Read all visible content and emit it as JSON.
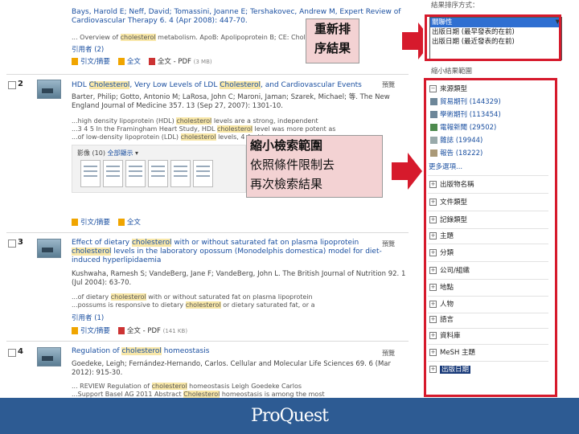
{
  "results": [
    {
      "num": "",
      "title_a": "Bays, Harold E; Neff, David; Tomassini, Joanne E; Tershakovec, Andrew M, Expert Review of",
      "title_b": "Cardiovascular Therapy 6. 4 (Apr 2008): 447-70.",
      "snippet": "... Overview of cholesterol metabolism. ApoB: Apolipoprotein B; CE: Chol",
      "cited": "引用者 (2)",
      "links": [
        "引文/摘要",
        "全文",
        "全文 - PDF"
      ],
      "pdf_size": "(3 MB)"
    },
    {
      "num": "2",
      "title_a": "HDL Cholesterol, Very Low Levels of LDL Cholesterol, and Cardiovascular Events",
      "meta_a": "Barter, Philip; Gotto, Antonio M; LaRosa, John C; Maroni, Jaman; Szarek, Michael; 等. The New",
      "meta_b": "England Journal of Medicine 357. 13 (Sep 27, 2007): 1301-10.",
      "snip_a": "...high density lipoprotein (HDL) cholesterol levels are a strong, independent",
      "snip_b": "...3 4 5 In the Framingham Heart Study, HDL cholesterol level was more potent as",
      "snip_c": "...of low-density lipoprotein (LDL) cholesterol levels, 4 And inv",
      "figures_label": "影像 (10)",
      "figures_all": "全部顯示",
      "links": [
        "引文/摘要",
        "全文"
      ],
      "preview": "預覽"
    },
    {
      "num": "3",
      "title_a": "Effect of dietary cholesterol with or without saturated fat on plasma lipoprotein",
      "title_b": "cholesterol levels in the laboratory opossum (Monodelphis domestica) model for diet-",
      "title_c": "induced hyperlipidaemia",
      "meta_a": "Kushwaha, Ramesh S; VandeBerg, Jane F; VandeBerg, John L. The British Journal of Nutrition 92. 1",
      "meta_b": "(Jul 2004): 63-70.",
      "snip_a": "...of dietary cholesterol with or without saturated fat on plasma lipoprotein",
      "snip_b": "...possums is responsive to dietary cholesterol or dietary saturated fat, or a",
      "cited": "引用者 (1)",
      "links": [
        "引文/摘要",
        "全文 - PDF"
      ],
      "pdf_size": "(141 KB)",
      "preview": "預覽"
    },
    {
      "num": "4",
      "title_a": "Regulation of cholesterol homeostasis",
      "meta_a": "Goedeke, Leigh; Fernández-Hernando, Carlos. Cellular and Molecular Life Sciences 69. 6 (Mar",
      "meta_b": "2012): 915-30.",
      "snip_a": "... REVIEW Regulation of cholesterol homeostasis Leigh Goedeke Carlos",
      "snip_b": "...Support Basel AG 2011 Abstract Cholesterol homeostasis is among the most",
      "preview": "預覽"
    }
  ],
  "callouts": {
    "resort": [
      "重新排",
      "序結果"
    ],
    "narrow": [
      "縮小檢索範圍",
      "依照條件限制去",
      "再次檢索結果"
    ]
  },
  "sort": {
    "heading": "結果排序方式：",
    "options": [
      "關聯性",
      "出版日期 (最早發表的在前)",
      "出版日期 (最近發表的在前)"
    ],
    "selected_index": 0
  },
  "narrow": {
    "heading": "縮小結果範圍",
    "source_type_label": "來源類型",
    "sources": [
      {
        "label": "貿易期刊 (144329)"
      },
      {
        "label": "學術期刊 (113454)"
      },
      {
        "label": "電報新聞 (29502)"
      },
      {
        "label": "雜誌 (19944)"
      },
      {
        "label": "報告 (18222)"
      }
    ],
    "more": "更多選項...",
    "facets": [
      "出版物名稱",
      "文件類型",
      "記錄類型",
      "主題",
      "分類",
      "公司/組織",
      "地點",
      "人物",
      "語言",
      "資料庫",
      "MeSH 主題",
      "出版日期"
    ]
  },
  "footer": {
    "logo": "ProQuest"
  }
}
